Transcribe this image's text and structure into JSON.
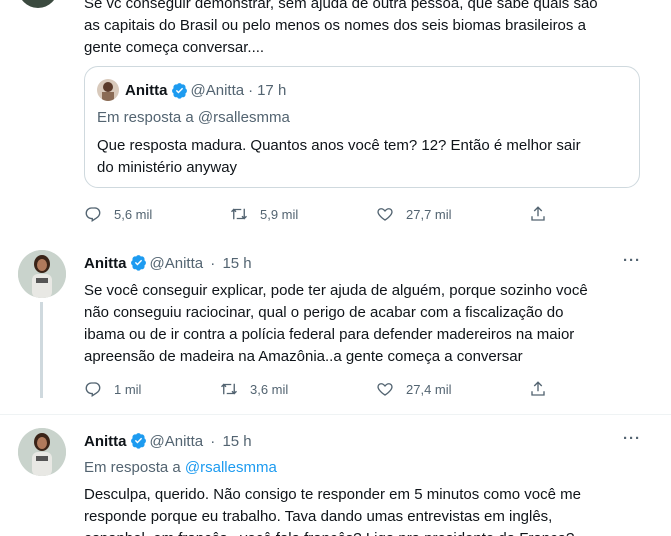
{
  "top_tweet": {
    "text_line1": "Se vc conseguir demonstrar, sem ajuda de outra pessoa, que sabe quais são",
    "text_line2": "as capitais do Brasil ou pelo menos os nomes dos seis biomas brasileiros a",
    "text_line3": "gente começa conversar....",
    "quote": {
      "name": "Anitta",
      "handle": "@Anitta",
      "dot": "·",
      "time": "17 h",
      "reply_prefix": "Em resposta a",
      "reply_to": "@rsallesmma",
      "text_line1": "Que resposta madura. Quantos anos você tem? 12? Então é melhor sair",
      "text_line2": "do ministério anyway"
    },
    "counts": {
      "replies": "5,6 mil",
      "retweets": "5,9 mil",
      "likes": "27,7 mil"
    }
  },
  "tweet2": {
    "name": "Anitta",
    "handle": "@Anitta",
    "dot": "·",
    "time": "15 h",
    "more": "···",
    "text_line1": "Se você conseguir explicar, pode ter ajuda de alguém, porque sozinho você",
    "text_line2": "não conseguiu raciocinar, qual o perigo de acabar com a fiscalização do",
    "text_line3": "ibama ou de ir contra a polícia federal para defender madereiros na maior",
    "text_line4": "apreensão de madeira na Amazônia..a gente começa a conversar",
    "counts": {
      "replies": "1 mil",
      "retweets": "3,6 mil",
      "likes": "27,4 mil"
    }
  },
  "tweet3": {
    "name": "Anitta",
    "handle": "@Anitta",
    "dot": "·",
    "time": "15 h",
    "more": "···",
    "reply_prefix": "Em resposta a",
    "reply_to": "@rsallesmma",
    "text_line1": "Desculpa, querido. Não consigo te responder em 5 minutos como você me",
    "text_line2": "responde porque eu trabalho. Tava dando umas entrevistas em inglês,",
    "text_line3": "espanhol, em francês...você fala francês? Liga pra presidente da França?"
  },
  "colors": {
    "link": "#1d9bf0",
    "muted": "#536471",
    "verified": "#1d9bf0"
  }
}
